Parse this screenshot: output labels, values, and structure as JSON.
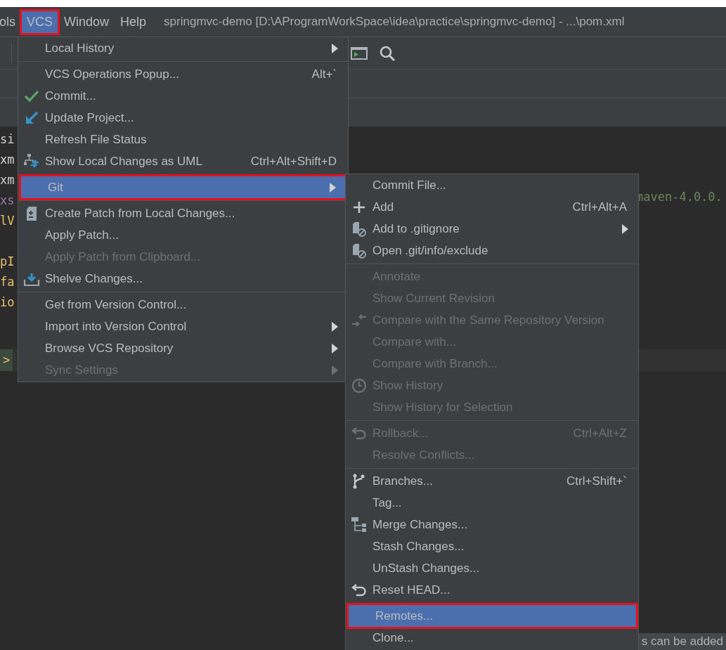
{
  "menubar": {
    "items": [
      {
        "label": "ols",
        "selected": false,
        "annotated": false
      },
      {
        "label": "VCS",
        "selected": true,
        "annotated": true
      },
      {
        "label": "Window",
        "selected": false,
        "annotated": false
      },
      {
        "label": "Help",
        "selected": false,
        "annotated": false
      }
    ],
    "title": "springmvc-demo [D:\\AProgramWorkSpace\\idea\\practice\\springmvc-demo] - ...\\pom.xml"
  },
  "editor": {
    "lines": [
      {
        "text": "si",
        "kind": "tag"
      },
      {
        "text": "xm",
        "kind": "tag"
      },
      {
        "text": "xm",
        "kind": "tag"
      },
      {
        "text": "xs",
        "kind": "attr"
      },
      {
        "text": "lV",
        "kind": "name"
      },
      {
        "kind": "blank"
      },
      {
        "text": "pI",
        "kind": "name"
      },
      {
        "text": "fa",
        "kind": "name"
      },
      {
        "text": "io",
        "kind": "name"
      }
    ],
    "caret_marker": ">",
    "right_text": "maven-4.0.0.",
    "status_hint": "s can be added"
  },
  "vcs_menu": [
    {
      "kind": "plain",
      "label": "Local History",
      "submenu": true,
      "disabled": false,
      "selected": false,
      "annotated": false
    },
    {
      "kind": "separator"
    },
    {
      "kind": "plain",
      "label": "VCS Operations Popup...",
      "shortcut": "Alt+`",
      "disabled": false,
      "selected": false,
      "annotated": false
    },
    {
      "kind": "check",
      "label": "Commit...",
      "disabled": false,
      "selected": false,
      "annotated": false
    },
    {
      "kind": "update",
      "label": "Update Project...",
      "disabled": false,
      "selected": false,
      "annotated": false
    },
    {
      "kind": "plain",
      "label": "Refresh File Status",
      "disabled": false,
      "selected": false,
      "annotated": false
    },
    {
      "kind": "diagram",
      "label": "Show Local Changes as UML",
      "shortcut": "Ctrl+Alt+Shift+D",
      "disabled": false,
      "selected": false,
      "annotated": false
    },
    {
      "kind": "separator"
    },
    {
      "kind": "plain",
      "label": "Git",
      "submenu": true,
      "disabled": false,
      "selected": true,
      "annotated": true
    },
    {
      "kind": "separator"
    },
    {
      "kind": "patch",
      "label": "Create Patch from Local Changes...",
      "disabled": false,
      "selected": false,
      "annotated": false
    },
    {
      "kind": "plain",
      "label": "Apply Patch...",
      "disabled": false,
      "selected": false,
      "annotated": false
    },
    {
      "kind": "plain",
      "label": "Apply Patch from Clipboard...",
      "disabled": true,
      "selected": false,
      "annotated": false
    },
    {
      "kind": "shelve",
      "label": "Shelve Changes...",
      "disabled": false,
      "selected": false,
      "annotated": false
    },
    {
      "kind": "separator"
    },
    {
      "kind": "plain",
      "label": "Get from Version Control...",
      "disabled": false,
      "selected": false,
      "annotated": false
    },
    {
      "kind": "plain",
      "label": "Import into Version Control",
      "submenu": true,
      "disabled": false,
      "selected": false,
      "annotated": false
    },
    {
      "kind": "plain",
      "label": "Browse VCS Repository",
      "submenu": true,
      "disabled": false,
      "selected": false,
      "annotated": false
    },
    {
      "kind": "plain",
      "label": "Sync Settings",
      "submenu": true,
      "disabled": true,
      "selected": false,
      "annotated": false
    }
  ],
  "git_menu": [
    {
      "kind": "plain",
      "label": "Commit File...",
      "disabled": false,
      "selected": false,
      "annotated": false
    },
    {
      "kind": "plus",
      "label": "Add",
      "shortcut": "Ctrl+Alt+A",
      "disabled": false,
      "selected": false,
      "annotated": false
    },
    {
      "kind": "file",
      "label": "Add to .gitignore",
      "submenu": true,
      "disabled": false,
      "selected": false,
      "annotated": false
    },
    {
      "kind": "file",
      "label": "Open .git/info/exclude",
      "disabled": false,
      "selected": false,
      "annotated": false
    },
    {
      "kind": "separator"
    },
    {
      "kind": "plain",
      "label": "Annotate",
      "disabled": true,
      "selected": false,
      "annotated": false
    },
    {
      "kind": "plain",
      "label": "Show Current Revision",
      "disabled": true,
      "selected": false,
      "annotated": false
    },
    {
      "kind": "arrows",
      "label": "Compare with the Same Repository Version",
      "disabled": true,
      "selected": false,
      "annotated": false
    },
    {
      "kind": "plain",
      "label": "Compare with...",
      "disabled": true,
      "selected": false,
      "annotated": false
    },
    {
      "kind": "plain",
      "label": "Compare with Branch...",
      "disabled": true,
      "selected": false,
      "annotated": false
    },
    {
      "kind": "clock",
      "label": "Show History",
      "disabled": true,
      "selected": false,
      "annotated": false
    },
    {
      "kind": "plain",
      "label": "Show History for Selection",
      "disabled": true,
      "selected": false,
      "annotated": false
    },
    {
      "kind": "separator"
    },
    {
      "kind": "undo",
      "label": "Rollback...",
      "shortcut": "Ctrl+Alt+Z",
      "disabled": true,
      "selected": false,
      "annotated": false
    },
    {
      "kind": "plain",
      "label": "Resolve Conflicts...",
      "disabled": true,
      "selected": false,
      "annotated": false
    },
    {
      "kind": "separator"
    },
    {
      "kind": "branch",
      "label": "Branches...",
      "shortcut": "Ctrl+Shift+`",
      "disabled": false,
      "selected": false,
      "annotated": false
    },
    {
      "kind": "plain",
      "label": "Tag...",
      "disabled": false,
      "selected": false,
      "annotated": false
    },
    {
      "kind": "tree",
      "label": "Merge Changes...",
      "disabled": false,
      "selected": false,
      "annotated": false
    },
    {
      "kind": "plain",
      "label": "Stash Changes...",
      "disabled": false,
      "selected": false,
      "annotated": false
    },
    {
      "kind": "plain",
      "label": "UnStash Changes...",
      "disabled": false,
      "selected": false,
      "annotated": false
    },
    {
      "kind": "undo",
      "label": "Reset HEAD...",
      "disabled": false,
      "selected": false,
      "annotated": false
    },
    {
      "kind": "separator"
    },
    {
      "kind": "plain",
      "label": "Remotes...",
      "disabled": false,
      "selected": true,
      "annotated": true
    },
    {
      "kind": "plain",
      "label": "Clone...",
      "disabled": false,
      "selected": false,
      "annotated": false
    }
  ]
}
